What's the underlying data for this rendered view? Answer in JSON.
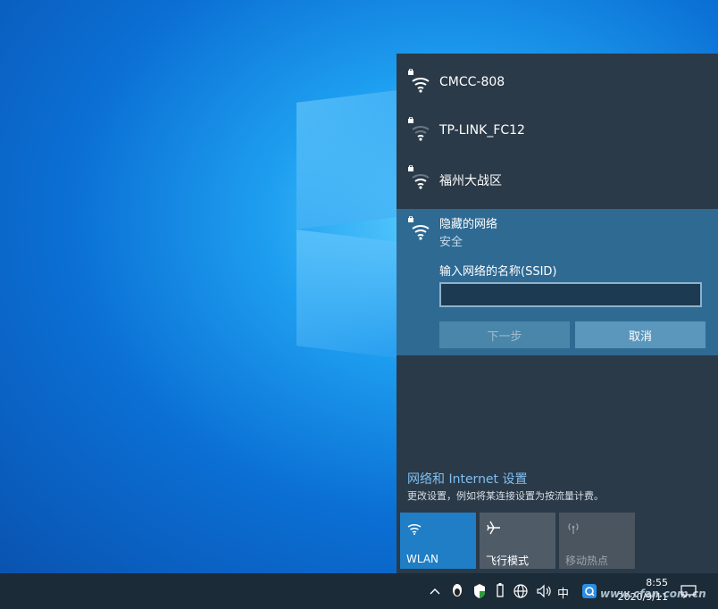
{
  "networks": [
    {
      "name": "CMCC-808",
      "secured": true,
      "signal": 4
    },
    {
      "name": "TP-LINK_FC12",
      "secured": true,
      "signal": 2
    },
    {
      "name": "福州大战区",
      "secured": true,
      "signal": 3
    }
  ],
  "hidden_network": {
    "name": "隐藏的网络",
    "security": "安全",
    "ssid_label": "输入网络的名称(SSID)",
    "ssid_value": "",
    "next_label": "下一步",
    "cancel_label": "取消"
  },
  "settings": {
    "title": "网络和 Internet 设置",
    "description": "更改设置，例如将某连接设置为按流量计费。"
  },
  "quick_actions": [
    {
      "label": "WLAN",
      "icon": "wifi-icon",
      "active": true
    },
    {
      "label": "飞行模式",
      "icon": "airplane-icon",
      "active": false
    },
    {
      "label": "移动热点",
      "icon": "hotspot-icon",
      "active": false,
      "disabled": true
    }
  ],
  "taskbar": {
    "time": "8:55",
    "date": "2020/9/11",
    "ime": "中",
    "watermark": "www.cfan.com.cn"
  },
  "colors": {
    "flyout_bg": "#2b3a48",
    "selected_bg": "#2f6a93",
    "accent": "#1f7ec5",
    "link": "#7fbff2"
  }
}
